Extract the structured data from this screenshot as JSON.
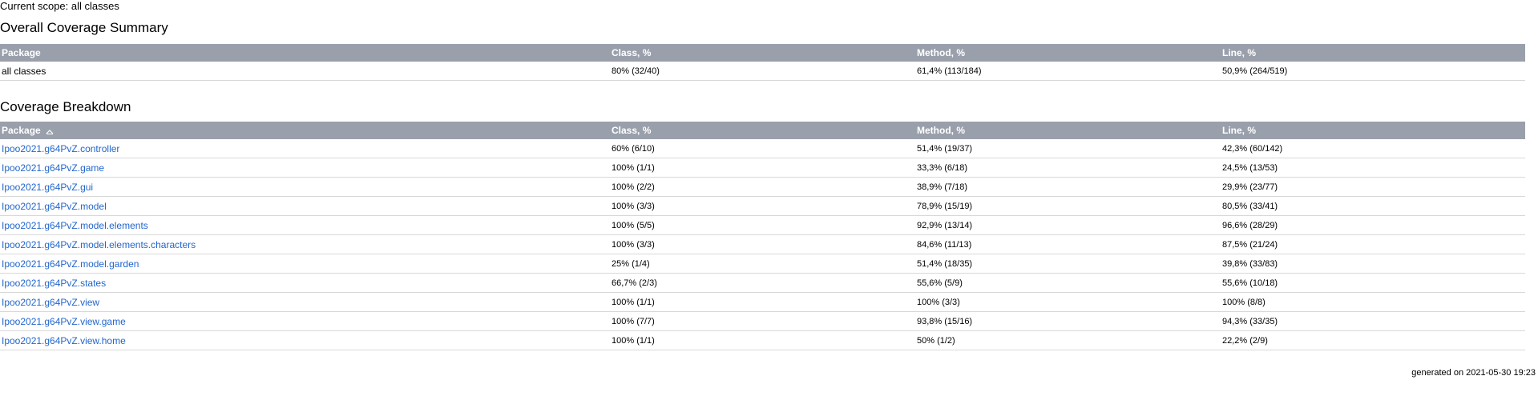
{
  "scope_text": "Current scope: all classes",
  "summary": {
    "title": "Overall Coverage Summary",
    "headers": [
      "Package",
      "Class, %",
      "Method, %",
      "Line, %"
    ],
    "rows": [
      {
        "name": "all classes",
        "class": "80% (32/40)",
        "method": "61,4% (113/184)",
        "line": "50,9% (264/519)"
      }
    ]
  },
  "breakdown": {
    "title": "Coverage Breakdown",
    "headers": [
      "Package",
      "Class, %",
      "Method, %",
      "Line, %"
    ],
    "sort_icon": "sort-ascending-icon",
    "rows": [
      {
        "name": "Ipoo2021.g64PvZ.controller",
        "class": "60% (6/10)",
        "method": "51,4% (19/37)",
        "line": "42,3% (60/142)"
      },
      {
        "name": "Ipoo2021.g64PvZ.game",
        "class": "100% (1/1)",
        "method": "33,3% (6/18)",
        "line": "24,5% (13/53)"
      },
      {
        "name": "Ipoo2021.g64PvZ.gui",
        "class": "100% (2/2)",
        "method": "38,9% (7/18)",
        "line": "29,9% (23/77)"
      },
      {
        "name": "Ipoo2021.g64PvZ.model",
        "class": "100% (3/3)",
        "method": "78,9% (15/19)",
        "line": "80,5% (33/41)"
      },
      {
        "name": "Ipoo2021.g64PvZ.model.elements",
        "class": "100% (5/5)",
        "method": "92,9% (13/14)",
        "line": "96,6% (28/29)"
      },
      {
        "name": "Ipoo2021.g64PvZ.model.elements.characters",
        "class": "100% (3/3)",
        "method": "84,6% (11/13)",
        "line": "87,5% (21/24)"
      },
      {
        "name": "Ipoo2021.g64PvZ.model.garden",
        "class": "25% (1/4)",
        "method": "51,4% (18/35)",
        "line": "39,8% (33/83)"
      },
      {
        "name": "Ipoo2021.g64PvZ.states",
        "class": "66,7% (2/3)",
        "method": "55,6% (5/9)",
        "line": "55,6% (10/18)"
      },
      {
        "name": "Ipoo2021.g64PvZ.view",
        "class": "100% (1/1)",
        "method": "100% (3/3)",
        "line": "100% (8/8)"
      },
      {
        "name": "Ipoo2021.g64PvZ.view.game",
        "class": "100% (7/7)",
        "method": "93,8% (15/16)",
        "line": "94,3% (33/35)"
      },
      {
        "name": "Ipoo2021.g64PvZ.view.home",
        "class": "100% (1/1)",
        "method": "50% (1/2)",
        "line": "22,2% (2/9)"
      }
    ]
  },
  "footer": "generated on 2021-05-30 19:23",
  "colors": {
    "header_bg": "#9aa0ab",
    "link": "#2266cc"
  }
}
